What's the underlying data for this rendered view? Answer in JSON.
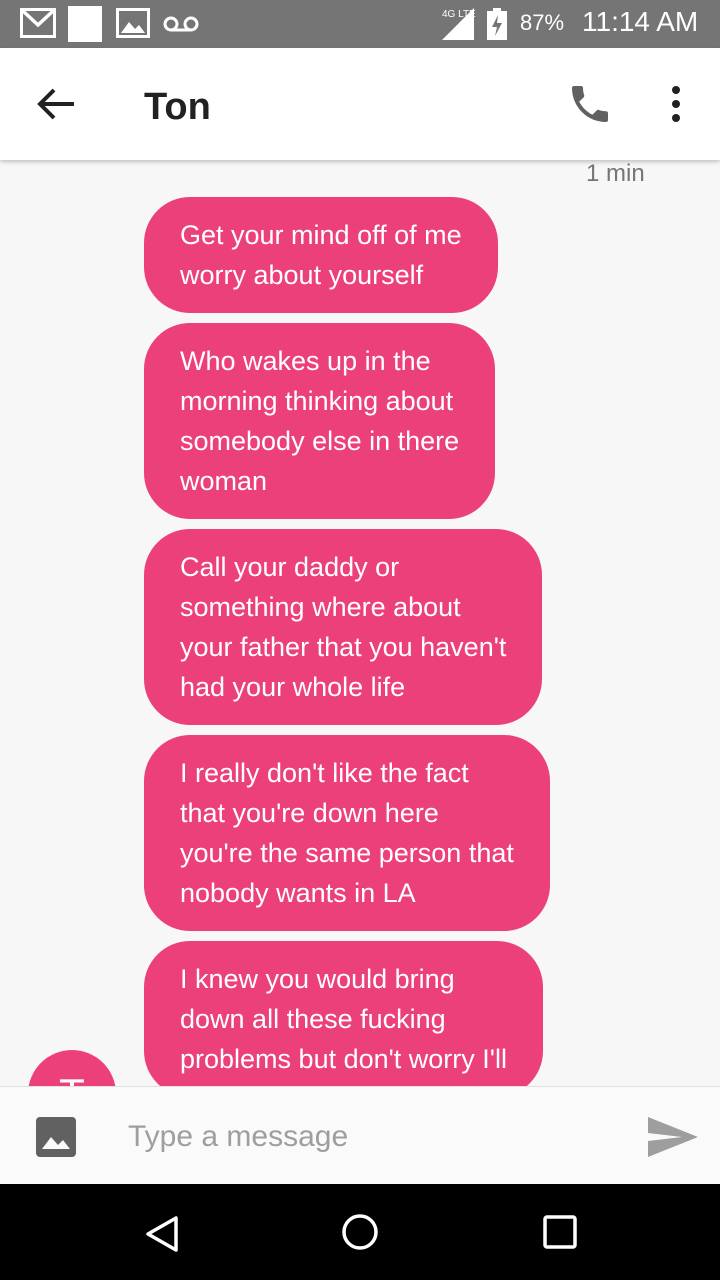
{
  "status_bar": {
    "icons": [
      "gmail-icon",
      "blank-notification-icon",
      "image-icon",
      "voicemail-icon",
      "signal-4g-lte-icon",
      "battery-charging-icon"
    ],
    "network": "4G LTE",
    "battery": "87%",
    "time": "11:14 AM"
  },
  "app_bar": {
    "contact_name": "Ton",
    "icons": [
      "back-arrow-icon",
      "phone-icon",
      "more-vert-icon"
    ]
  },
  "conversation": {
    "timestamp": "1 min",
    "messages": [
      "Get your mind off of me\nworry about yourself",
      "Who wakes up in the\nmorning thinking about\nsomebody else in there\nwoman",
      "Call your daddy or\nsomething where about\nyour father that you haven't\nhad your whole life",
      "I really don't like the fact\nthat you're down here\nyou're the same person that\nnobody wants in LA",
      "I knew you would bring\ndown all these fucking\nproblems but don't worry I'll"
    ],
    "avatar_initial": "T",
    "bubble_color": "#ec407a"
  },
  "compose": {
    "placeholder": "Type a message",
    "icons": [
      "attach-image-icon",
      "send-icon"
    ]
  },
  "nav_bar": {
    "icons": [
      "nav-back-icon",
      "nav-home-icon",
      "nav-recents-icon"
    ]
  }
}
